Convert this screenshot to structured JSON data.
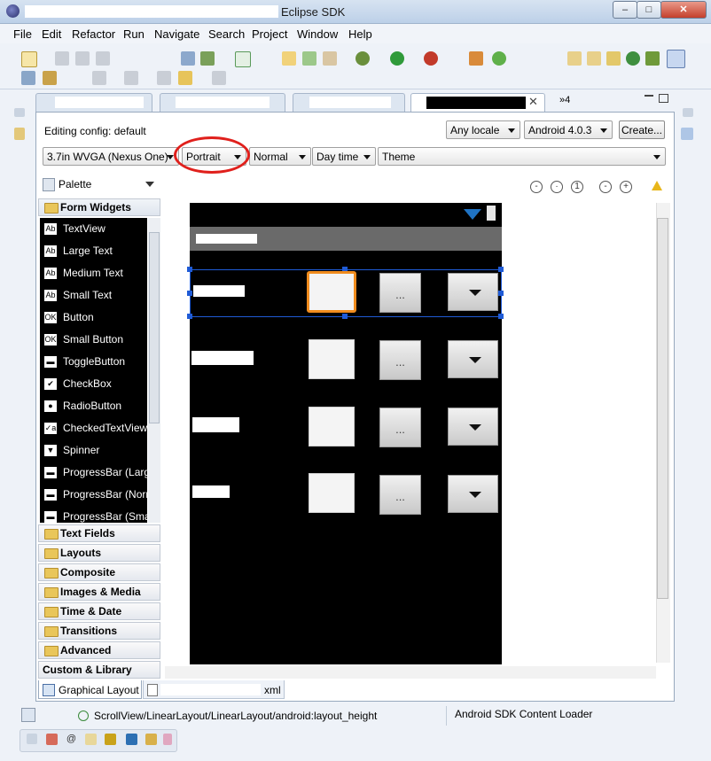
{
  "window": {
    "title": "Eclipse SDK",
    "controls": {
      "minimize": "–",
      "maximize": "□",
      "close": "✕"
    }
  },
  "menu": [
    "File",
    "Edit",
    "Refactor",
    "Run",
    "Navigate",
    "Search",
    "Project",
    "Window",
    "Help"
  ],
  "editor_tabs": {
    "overflow_count": "»4"
  },
  "config": {
    "editing_config": "Editing config: default",
    "locale": "Any locale",
    "android_version": "Android 4.0.3",
    "create_button": "Create...",
    "device": "3.7in WVGA (Nexus One)",
    "orientation": "Portrait",
    "dock_mode": "Normal",
    "night_mode": "Day time",
    "theme": "Theme"
  },
  "palette": {
    "title": "Palette",
    "open_category": "Form Widgets",
    "widgets": [
      {
        "icon": "Ab",
        "label": "TextView"
      },
      {
        "icon": "Ab",
        "label": "Large Text"
      },
      {
        "icon": "Ab",
        "label": "Medium Text"
      },
      {
        "icon": "Ab",
        "label": "Small Text"
      },
      {
        "icon": "OK",
        "label": "Button"
      },
      {
        "icon": "OK",
        "label": "Small Button"
      },
      {
        "icon": "▬",
        "label": "ToggleButton"
      },
      {
        "icon": "✔",
        "label": "CheckBox"
      },
      {
        "icon": "●",
        "label": "RadioButton"
      },
      {
        "icon": "✓a",
        "label": "CheckedTextView"
      },
      {
        "icon": "▼",
        "label": "Spinner"
      },
      {
        "icon": "▬",
        "label": "ProgressBar (Large)"
      },
      {
        "icon": "▬",
        "label": "ProgressBar (Normal)"
      },
      {
        "icon": "▬",
        "label": "ProgressBar (Small)"
      }
    ],
    "categories": [
      "Text Fields",
      "Layouts",
      "Composite",
      "Images & Media",
      "Time & Date",
      "Transitions",
      "Advanced"
    ],
    "custom_views": "Custom & Library Views"
  },
  "device_rows": [
    {
      "button_label": "..."
    },
    {
      "button_label": "..."
    },
    {
      "button_label": "..."
    },
    {
      "button_label": "..."
    }
  ],
  "bottom_tabs": {
    "graphical_layout": "Graphical Layout",
    "xml_tab_suffix": "xml"
  },
  "status": {
    "path": "ScrollView/LinearLayout/LinearLayout/android:layout_height",
    "loader": "Android SDK Content Loader"
  },
  "colors": {
    "accent_highlight": "#f08c1e",
    "annotation_circle": "#e0201c",
    "selection": "#1f5bd6"
  }
}
